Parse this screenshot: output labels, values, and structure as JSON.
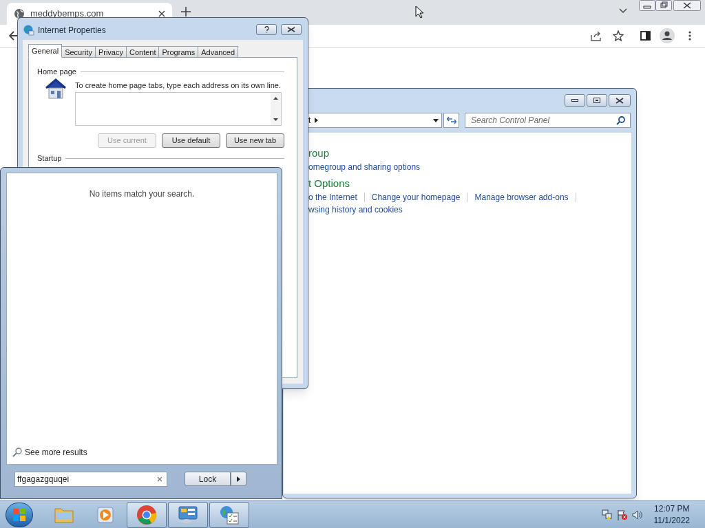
{
  "browser": {
    "tab_title": "meddybemps.com"
  },
  "dialog": {
    "title": "Internet Properties",
    "tabs": [
      {
        "label": "General",
        "selected": true
      },
      {
        "label": "Security",
        "selected": false
      },
      {
        "label": "Privacy",
        "selected": false
      },
      {
        "label": "Content",
        "selected": false
      },
      {
        "label": "Programs",
        "selected": false
      },
      {
        "label": "Advanced",
        "selected": false
      }
    ],
    "home_page": {
      "legend": "Home page",
      "instruction": "To create home page tabs, type each address on its own line.",
      "buttons": [
        {
          "label": "Use current",
          "disabled": true
        },
        {
          "label": "Use default",
          "disabled": false
        },
        {
          "label": "Use new tab",
          "disabled": false
        }
      ]
    },
    "startup": {
      "legend": "Startup"
    }
  },
  "control_panel": {
    "breadcrumb": "t",
    "search": {
      "placeholder": "Search Control Panel"
    },
    "sections": [
      {
        "heading": "roup",
        "link_lines": [
          [
            "omegroup and sharing options"
          ]
        ]
      },
      {
        "heading": "t Options",
        "link_lines": [
          [
            "o the Internet",
            "Change your homepage",
            "Manage browser add-ons"
          ],
          [
            "wsing history and cookies"
          ]
        ]
      }
    ]
  },
  "start_menu": {
    "message": "No items match your search.",
    "see_more": "See more results",
    "search": {
      "value": "ffgagazgquqei"
    },
    "power_button": "Lock"
  },
  "taskbar": {
    "items": [
      {
        "kind": "folder",
        "active": false
      },
      {
        "kind": "media",
        "active": false
      },
      {
        "kind": "chrome",
        "active": true
      },
      {
        "kind": "control-panel",
        "active": true
      },
      {
        "kind": "internet-options",
        "active": true
      }
    ],
    "time": "12:07 PM",
    "date": "11/1/2022"
  }
}
